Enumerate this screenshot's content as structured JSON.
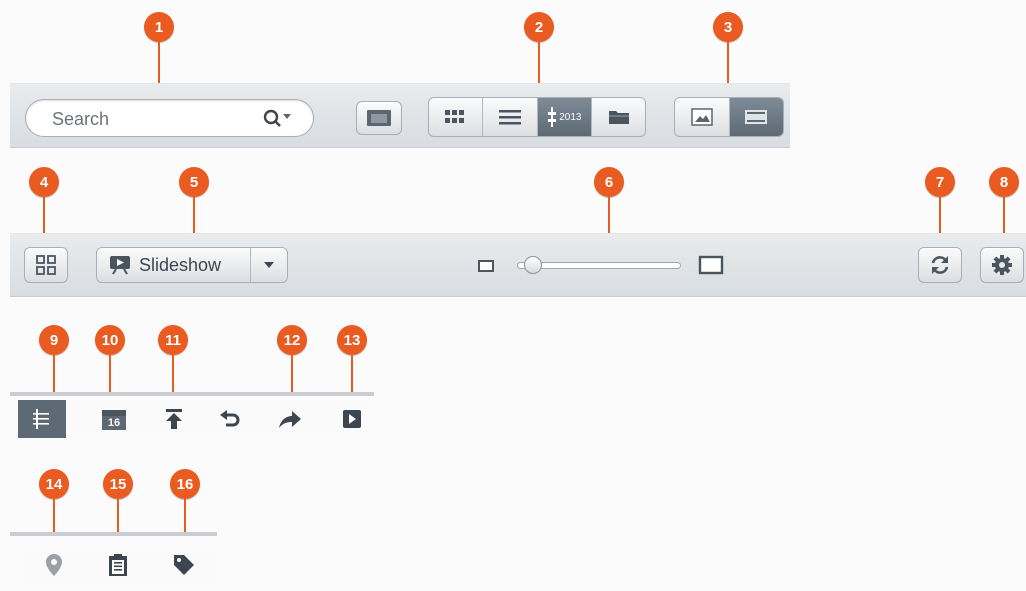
{
  "callouts": [
    "1",
    "2",
    "3",
    "4",
    "5",
    "6",
    "7",
    "8",
    "9",
    "10",
    "11",
    "12",
    "13",
    "14",
    "15",
    "16"
  ],
  "toolbar_top": {
    "search": {
      "placeholder": "Search",
      "icon": "search-icon"
    },
    "filmstrip_button": {
      "icon": "panel-icon"
    },
    "view_modes": [
      {
        "icon": "thumbnail-grid-icon"
      },
      {
        "icon": "list-icon"
      },
      {
        "icon": "timeline-icon",
        "label": "2013",
        "active": true
      },
      {
        "icon": "folder-icon"
      }
    ],
    "display_modes": [
      {
        "icon": "image-icon"
      },
      {
        "icon": "filmstrip-icon",
        "active": true
      }
    ]
  },
  "toolbar_second": {
    "layout_button": {
      "icon": "layout-icon"
    },
    "slideshow": {
      "label": "Slideshow",
      "icon": "slideshow-icon",
      "dropdown_icon": "caret-down-icon"
    },
    "zoom_slider": {
      "value": 0.05
    },
    "refresh_button": {
      "icon": "refresh-icon"
    },
    "settings_button": {
      "icon": "gear-icon"
    }
  },
  "action_row": {
    "items": [
      {
        "icon": "timeline-icon",
        "active": true
      },
      {
        "icon": "calendar-icon",
        "label": "16"
      },
      {
        "icon": "upload-icon"
      },
      {
        "icon": "undo-icon"
      },
      {
        "icon": "share-icon"
      },
      {
        "icon": "play-icon"
      }
    ]
  },
  "info_row": {
    "items": [
      {
        "icon": "location-icon"
      },
      {
        "icon": "clipboard-icon"
      },
      {
        "icon": "tag-icon"
      }
    ]
  },
  "colors": {
    "callout": "#ea5b22",
    "active": "#5d6a76"
  }
}
